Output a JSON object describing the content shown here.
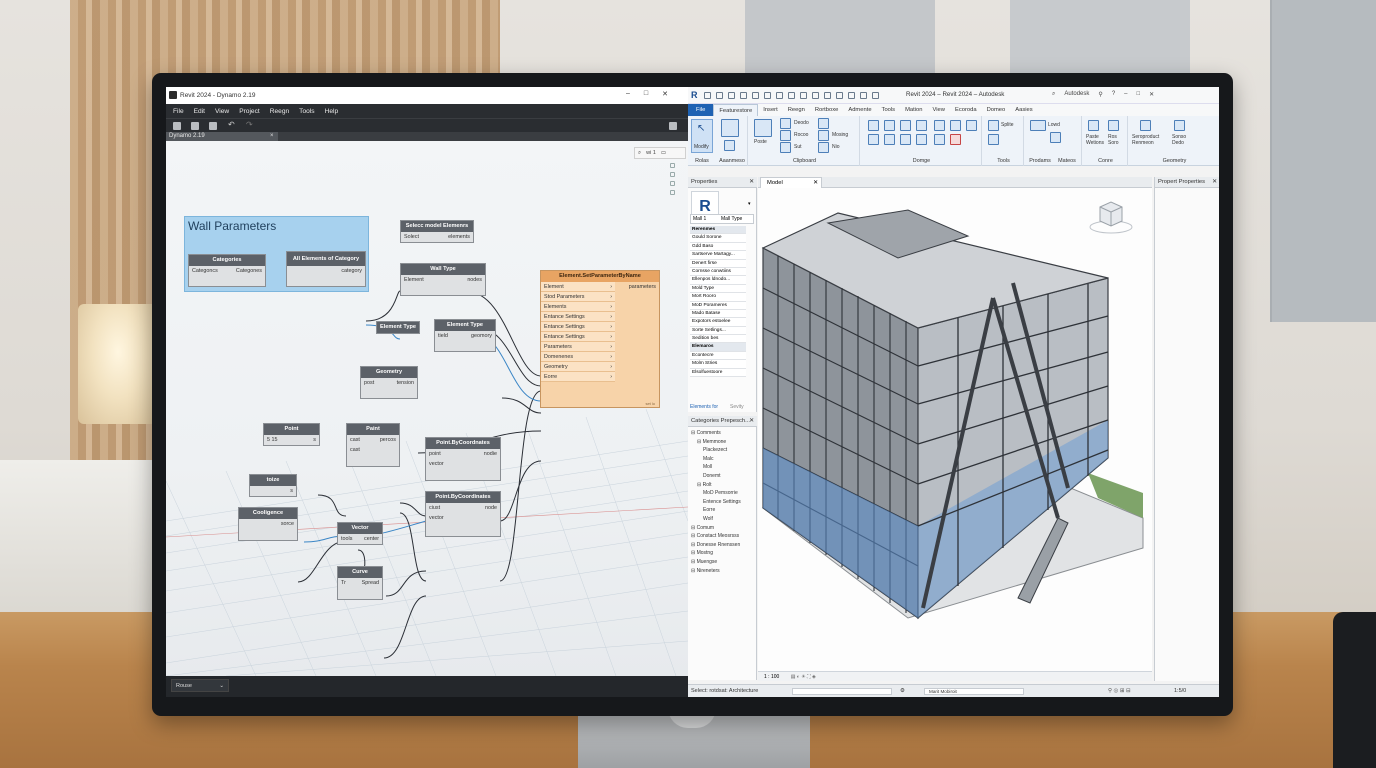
{
  "dynamo": {
    "title": "Revit 2024 - Dynamo 2.19",
    "menu": [
      "File",
      "Edit",
      "View",
      "Project",
      "Reegn",
      "Tools",
      "Help"
    ],
    "tab_label": "Dynamo 2.19",
    "tab_close": "×",
    "search_zoom": "wi 1",
    "status_mode": "Rouse",
    "group_title": "Wall Parameters",
    "nodes": {
      "categories": {
        "title": "Categories",
        "in": "Categoncs",
        "out": "Categones"
      },
      "all_elements": {
        "title": "All Elements of Category",
        "out": "category"
      },
      "select_model": {
        "title": "Selecc model Elemenrs",
        "in": "Solect",
        "out": "elements"
      },
      "wall_type": {
        "title": "Wall Type",
        "in": "Element",
        "out": "nodes"
      },
      "element_type_label": {
        "title": "Element Type"
      },
      "element_type": {
        "title": "Element Type",
        "in": "tield",
        "out": "geomory"
      },
      "geometry": {
        "title": "Geometry",
        "in": "post",
        "out": "tension"
      },
      "set_param": {
        "title": "Element.SetParameterByName",
        "out": "parameters",
        "rows": [
          "Element",
          "Stod Parameters",
          "Elements",
          "Entance Settings",
          "Entance Settings",
          "Entance Settings",
          "Parameters",
          "Domenenes",
          "Geometry",
          "Eorre"
        ],
        "footer": "set lo"
      },
      "point": {
        "title": "Point",
        "in": "5 15",
        "out": "s"
      },
      "paint": {
        "title": "Paint",
        "in1": "cast",
        "in2": "cast",
        "out": "percos"
      },
      "point_by_coords_1": {
        "title": "Point.ByCoordnates",
        "in1": "point",
        "in2": "vector",
        "out": "nodie"
      },
      "point_by_coords_2": {
        "title": "Point.ByCoordinates",
        "in1": "ciust",
        "in2": "vector",
        "out": "node"
      },
      "toize": {
        "title": "toize",
        "in": "",
        "out": "s"
      },
      "cooligence": {
        "title": "Cooligence",
        "in": "",
        "out": "sorce"
      },
      "vector": {
        "title": "Vector",
        "in": "tools",
        "out": "center"
      },
      "curve": {
        "title": "Curve",
        "in": "Tr",
        "out": "Spread"
      }
    }
  },
  "revit": {
    "title": "Revit 2024 – Revit 2024 – Autodesk",
    "user": "Autodesk",
    "tabs": [
      "File",
      "Featurestore",
      "Insert",
      "Reegn",
      "Rortboxe",
      "Admente",
      "Tools",
      "Mation",
      "View",
      "Ecoroda",
      "Domeo",
      "Aasies"
    ],
    "ribbon": {
      "modify": "Modify",
      "select": "Rolas",
      "properties": "Aaanmeso",
      "clipboard": "Clipboard",
      "geometry": "Domge",
      "tools": "Tools",
      "product": "Prodams",
      "mateos": "Mateos",
      "core": "Conre",
      "geometry2": "Geometry",
      "items": [
        "Poste",
        "Deodo",
        "Rocoo",
        "Sut",
        "Nio",
        "Mosing",
        "Splite",
        "Lowd",
        "Paste Wetions",
        "Ros Soro",
        "Seroproduct Renmeon",
        "Sonso Dedo"
      ]
    },
    "properties": {
      "header": "Properties",
      "logo": "R",
      "type": "Mall 1",
      "type_label": "Mall Type",
      "rows": [
        {
          "text": "Rerenmes",
          "hd": true
        },
        {
          "text": "Gould Sorone"
        },
        {
          "text": "Gdd Baso"
        },
        {
          "text": "Sartserve Martagy..."
        },
        {
          "text": "Denert firse"
        },
        {
          "text": "Cornsse conwtiins"
        },
        {
          "text": "Ellenpos ldnodo..."
        },
        {
          "text": "Mold Type"
        },
        {
          "text": "Mort Rooro"
        },
        {
          "text": "MoD Porameres"
        },
        {
          "text": "Mado Batase"
        },
        {
          "text": "Expotors estoelee"
        },
        {
          "text": "Sorte Setlings..."
        },
        {
          "text": "Sedition bes"
        },
        {
          "text": "Elemaros",
          "hd": true
        },
        {
          "text": "Econtecre"
        },
        {
          "text": "Molm Stries"
        },
        {
          "text": "Elsolfuestoore"
        }
      ],
      "footer_link": "Elements for",
      "footer_btn": "Sevity"
    },
    "browser": {
      "header": "Categories Prepesch...",
      "items": [
        "Comments",
        "Memmone",
        "Plackezect",
        "Malc",
        "Moll",
        "Donemt",
        "Rolt",
        "MoD Pemsorrie",
        "Entence Settings",
        "Eorre",
        "Wolf",
        "Comum",
        "Constact Meosrsss",
        "Donesse Rnenssen",
        "Mostng",
        "Muengse",
        "Nireneters"
      ]
    },
    "view": {
      "tab": "Model",
      "scale": "1 : 100"
    },
    "property_panel": {
      "header": "Propert Properties"
    },
    "status": {
      "left": "Select: rotdsat: Architecture",
      "mid": "Marit Mobiroit",
      "right": "1:5/0"
    }
  },
  "colors": {
    "accent": "#1e62b3",
    "orange_node": "#f7d3a9",
    "group": "#a7d1ee",
    "dynamo_bar": "#2a2d31"
  }
}
